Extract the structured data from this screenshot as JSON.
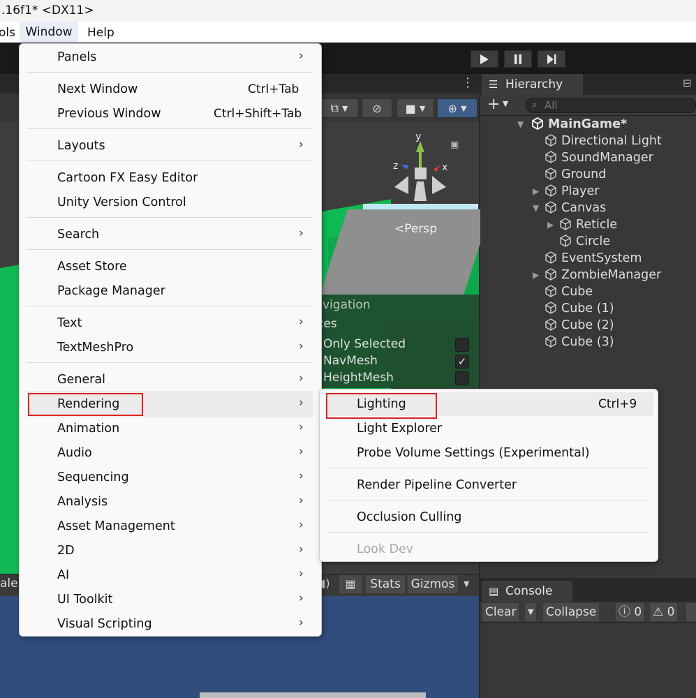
{
  "window": {
    "title": ".16f1* <DX11>"
  },
  "menubar": {
    "tools": "ols",
    "window": "Window",
    "help": "Help"
  },
  "scene": {
    "persp_label": "Persp",
    "gizmo": {
      "x": "x",
      "y": "y",
      "z": "z"
    },
    "nav_overlay": {
      "title_fragment": "vigation",
      "section_fragment": "ces",
      "options": [
        {
          "label": "Only Selected",
          "checked": false
        },
        {
          "label": "NavMesh",
          "checked": true
        },
        {
          "label": "HeightMesh",
          "checked": false
        }
      ],
      "check_mark": "✓"
    }
  },
  "hierarchy": {
    "tab_label": "Hierarchy",
    "search_placeholder": "All",
    "scene_name": "MainGame*",
    "items": [
      {
        "label": "Directional Light"
      },
      {
        "label": "SoundManager"
      },
      {
        "label": "Ground"
      },
      {
        "label": "Player"
      },
      {
        "label": "Canvas"
      },
      {
        "label": "Reticle"
      },
      {
        "label": "Circle"
      },
      {
        "label": "EventSystem"
      },
      {
        "label": "ZombieManager"
      },
      {
        "label": "Cube"
      },
      {
        "label": "Cube (1)"
      },
      {
        "label": "Cube (2)"
      },
      {
        "label": "Cube (3)"
      }
    ]
  },
  "game_toolbar": {
    "scale_fragment": "ale",
    "stats": "Stats",
    "gizmos": "Gizmos"
  },
  "console": {
    "tab_label": "Console",
    "clear": "Clear",
    "collapse": "Collapse",
    "info_count": "0",
    "warn_count": "0"
  },
  "menu": {
    "items": {
      "panels": "Panels",
      "next_window": "Next Window",
      "next_window_shortcut": "Ctrl+Tab",
      "previous_window": "Previous Window",
      "previous_window_shortcut": "Ctrl+Shift+Tab",
      "layouts": "Layouts",
      "cartoon_fx": "Cartoon FX Easy Editor",
      "unity_vc": "Unity Version Control",
      "search": "Search",
      "asset_store": "Asset Store",
      "package_manager": "Package Manager",
      "text": "Text",
      "textmeshpro": "TextMeshPro",
      "general": "General",
      "rendering": "Rendering",
      "animation": "Animation",
      "audio": "Audio",
      "sequencing": "Sequencing",
      "analysis": "Analysis",
      "asset_management": "Asset Management",
      "twod": "2D",
      "ai": "AI",
      "ui_toolkit": "UI Toolkit",
      "visual_scripting": "Visual Scripting"
    },
    "arrow": "›"
  },
  "submenu": {
    "lighting": "Lighting",
    "lighting_shortcut": "Ctrl+9",
    "light_explorer": "Light Explorer",
    "probe_volume": "Probe Volume Settings (Experimental)",
    "render_pipeline": "Render Pipeline Converter",
    "occlusion": "Occlusion Culling",
    "look_dev": "Look Dev"
  },
  "colors": {
    "highlight_box": "#e02222",
    "unity_dark": "#383838",
    "scene_green": "#0fb954"
  }
}
